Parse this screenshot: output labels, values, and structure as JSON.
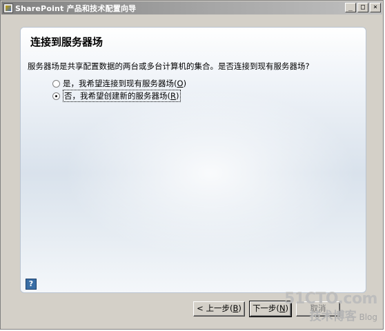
{
  "window": {
    "title": "SharePoint 产品和技术配置向导",
    "controls": {
      "minimize": "_",
      "restore": "□",
      "close": "×"
    }
  },
  "page": {
    "heading": "连接到服务器场",
    "description": "服务器场是共享配置数据的两台或多台计算机的集合。是否连接到现有服务器场?"
  },
  "options": [
    {
      "text": "是，我希望连接到现有服务器场",
      "hotkey": "O",
      "suffix_open": "(",
      "suffix_close": ")",
      "checked": false
    },
    {
      "text": "否，我希望创建新的服务器场",
      "hotkey": "R",
      "suffix_open": "(",
      "suffix_close": ")",
      "checked": true
    }
  ],
  "help": {
    "icon": "help-icon",
    "glyph": "?"
  },
  "buttons": {
    "back": {
      "text": "< 上一步(",
      "hotkey": "B",
      "close": ")"
    },
    "next": {
      "text": "下一步(",
      "hotkey": "N",
      "close": ")"
    },
    "cancel": {
      "text": "取消"
    }
  },
  "watermark": {
    "main": "51CTO.com",
    "sub_cn": "技术博客",
    "sub_en": "Blog"
  }
}
